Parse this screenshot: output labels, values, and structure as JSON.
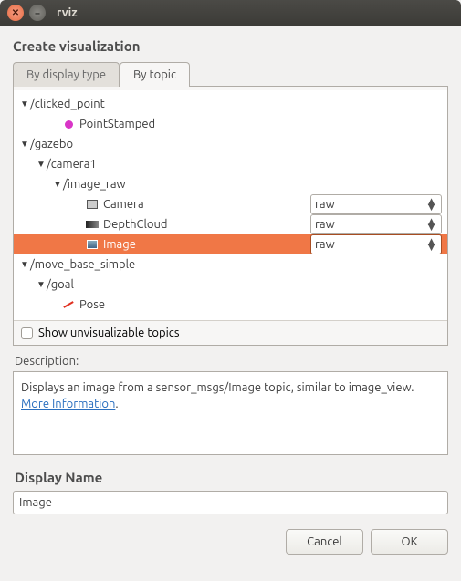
{
  "window": {
    "title": "rviz"
  },
  "dialog": {
    "heading": "Create visualization",
    "tabs": {
      "by_display_type": "By display type",
      "by_topic": "By topic"
    },
    "tree": {
      "clicked_point": {
        "path": "/clicked_point",
        "type": "PointStamped"
      },
      "gazebo": {
        "path": "/gazebo",
        "camera1": {
          "path": "/camera1",
          "image_raw": {
            "path": "/image_raw",
            "camera": {
              "label": "Camera",
              "transport": "raw"
            },
            "depthcloud": {
              "label": "DepthCloud",
              "transport": "raw"
            },
            "image": {
              "label": "Image",
              "transport": "raw"
            }
          }
        }
      },
      "move_base_simple": {
        "path": "/move_base_simple",
        "goal": {
          "path": "/goal",
          "pose": "Pose"
        }
      }
    },
    "show_unvisualizable": "Show unvisualizable topics",
    "description_label": "Description:",
    "description_text": "Displays an image from a sensor_msgs/Image topic, similar to image_view. ",
    "more_info": "More Information",
    "period": ".",
    "display_name_label": "Display Name",
    "display_name_value": "Image",
    "buttons": {
      "cancel": "Cancel",
      "ok": "OK"
    }
  }
}
